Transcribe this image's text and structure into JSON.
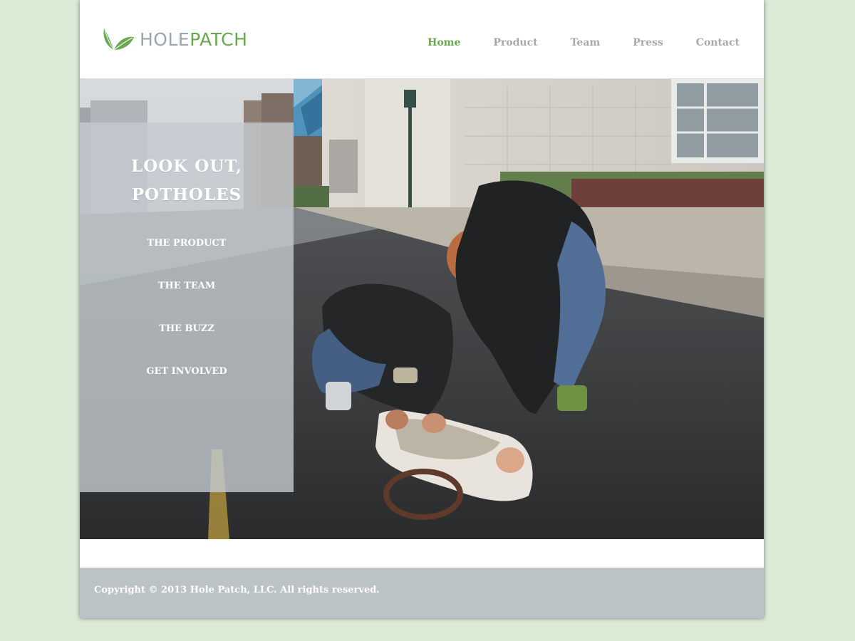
{
  "brand": {
    "name_part1": "HOLE",
    "name_part2": "PATCH",
    "leaf_color": "#6aa84f",
    "gray_color": "#9aa6ad"
  },
  "nav": {
    "items": [
      {
        "label": "Home",
        "active": true
      },
      {
        "label": "Product",
        "active": false
      },
      {
        "label": "Team",
        "active": false
      },
      {
        "label": "Press",
        "active": false
      },
      {
        "label": "Contact",
        "active": false
      }
    ]
  },
  "hero": {
    "headline_line1": "LOOK OUT,",
    "headline_line2": "POTHOLES",
    "links": [
      {
        "label": "THE PRODUCT"
      },
      {
        "label": "THE TEAM"
      },
      {
        "label": "THE BUZZ"
      },
      {
        "label": "GET INVOLVED"
      }
    ],
    "photo": "two-men-patching-pothole-photo"
  },
  "footer": {
    "copyright": "Copyright © 2013 Hole Patch, LLC. All rights reserved."
  },
  "colors": {
    "background": "#dcebd6",
    "accent": "#6aa84f",
    "nav_inactive": "#a4a9ac",
    "footer": "#bcc3c4"
  }
}
